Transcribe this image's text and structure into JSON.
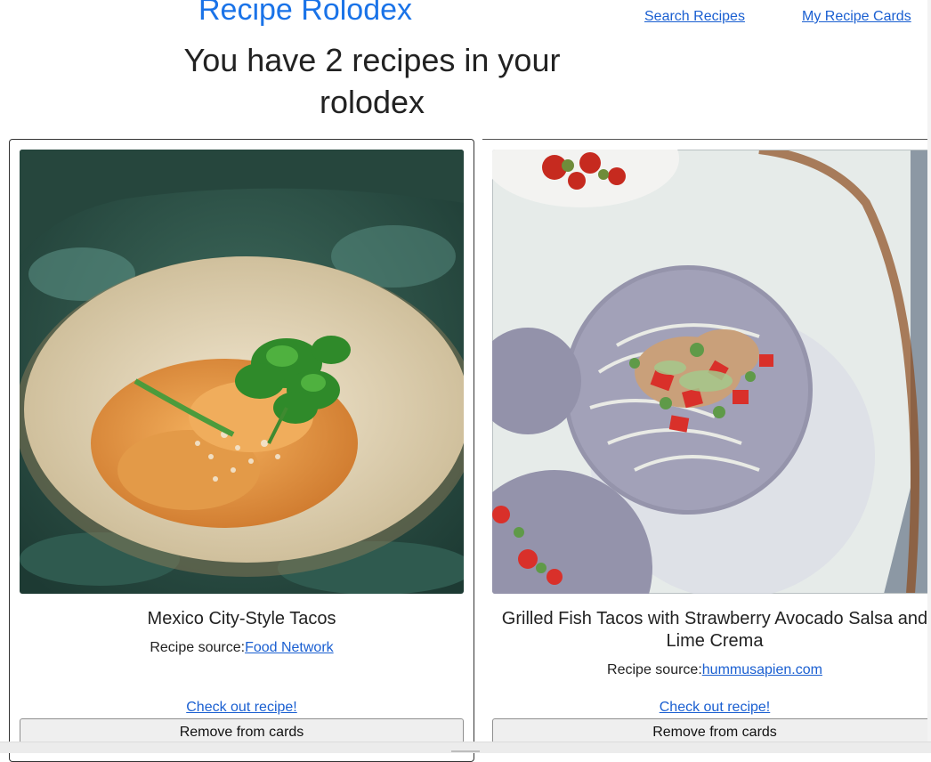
{
  "header": {
    "brand": "Recipe Rolodex",
    "nav": [
      {
        "label": "Search Recipes"
      },
      {
        "label": "My Recipe Cards"
      }
    ],
    "subtitle": "You have 2 recipes in your rolodex"
  },
  "recipes": [
    {
      "title": "Mexico City-Style Tacos",
      "source_prefix": "Recipe source:",
      "source_name": "Food Network",
      "check_label": "Check out recipe!",
      "remove_label": "Remove from cards"
    },
    {
      "title": "Grilled Fish Tacos with Strawberry Avocado Salsa and Lime Crema",
      "source_prefix": "Recipe source:",
      "source_name": "hummusapien.com",
      "check_label": "Check out recipe!",
      "remove_label": "Remove from cards"
    }
  ]
}
